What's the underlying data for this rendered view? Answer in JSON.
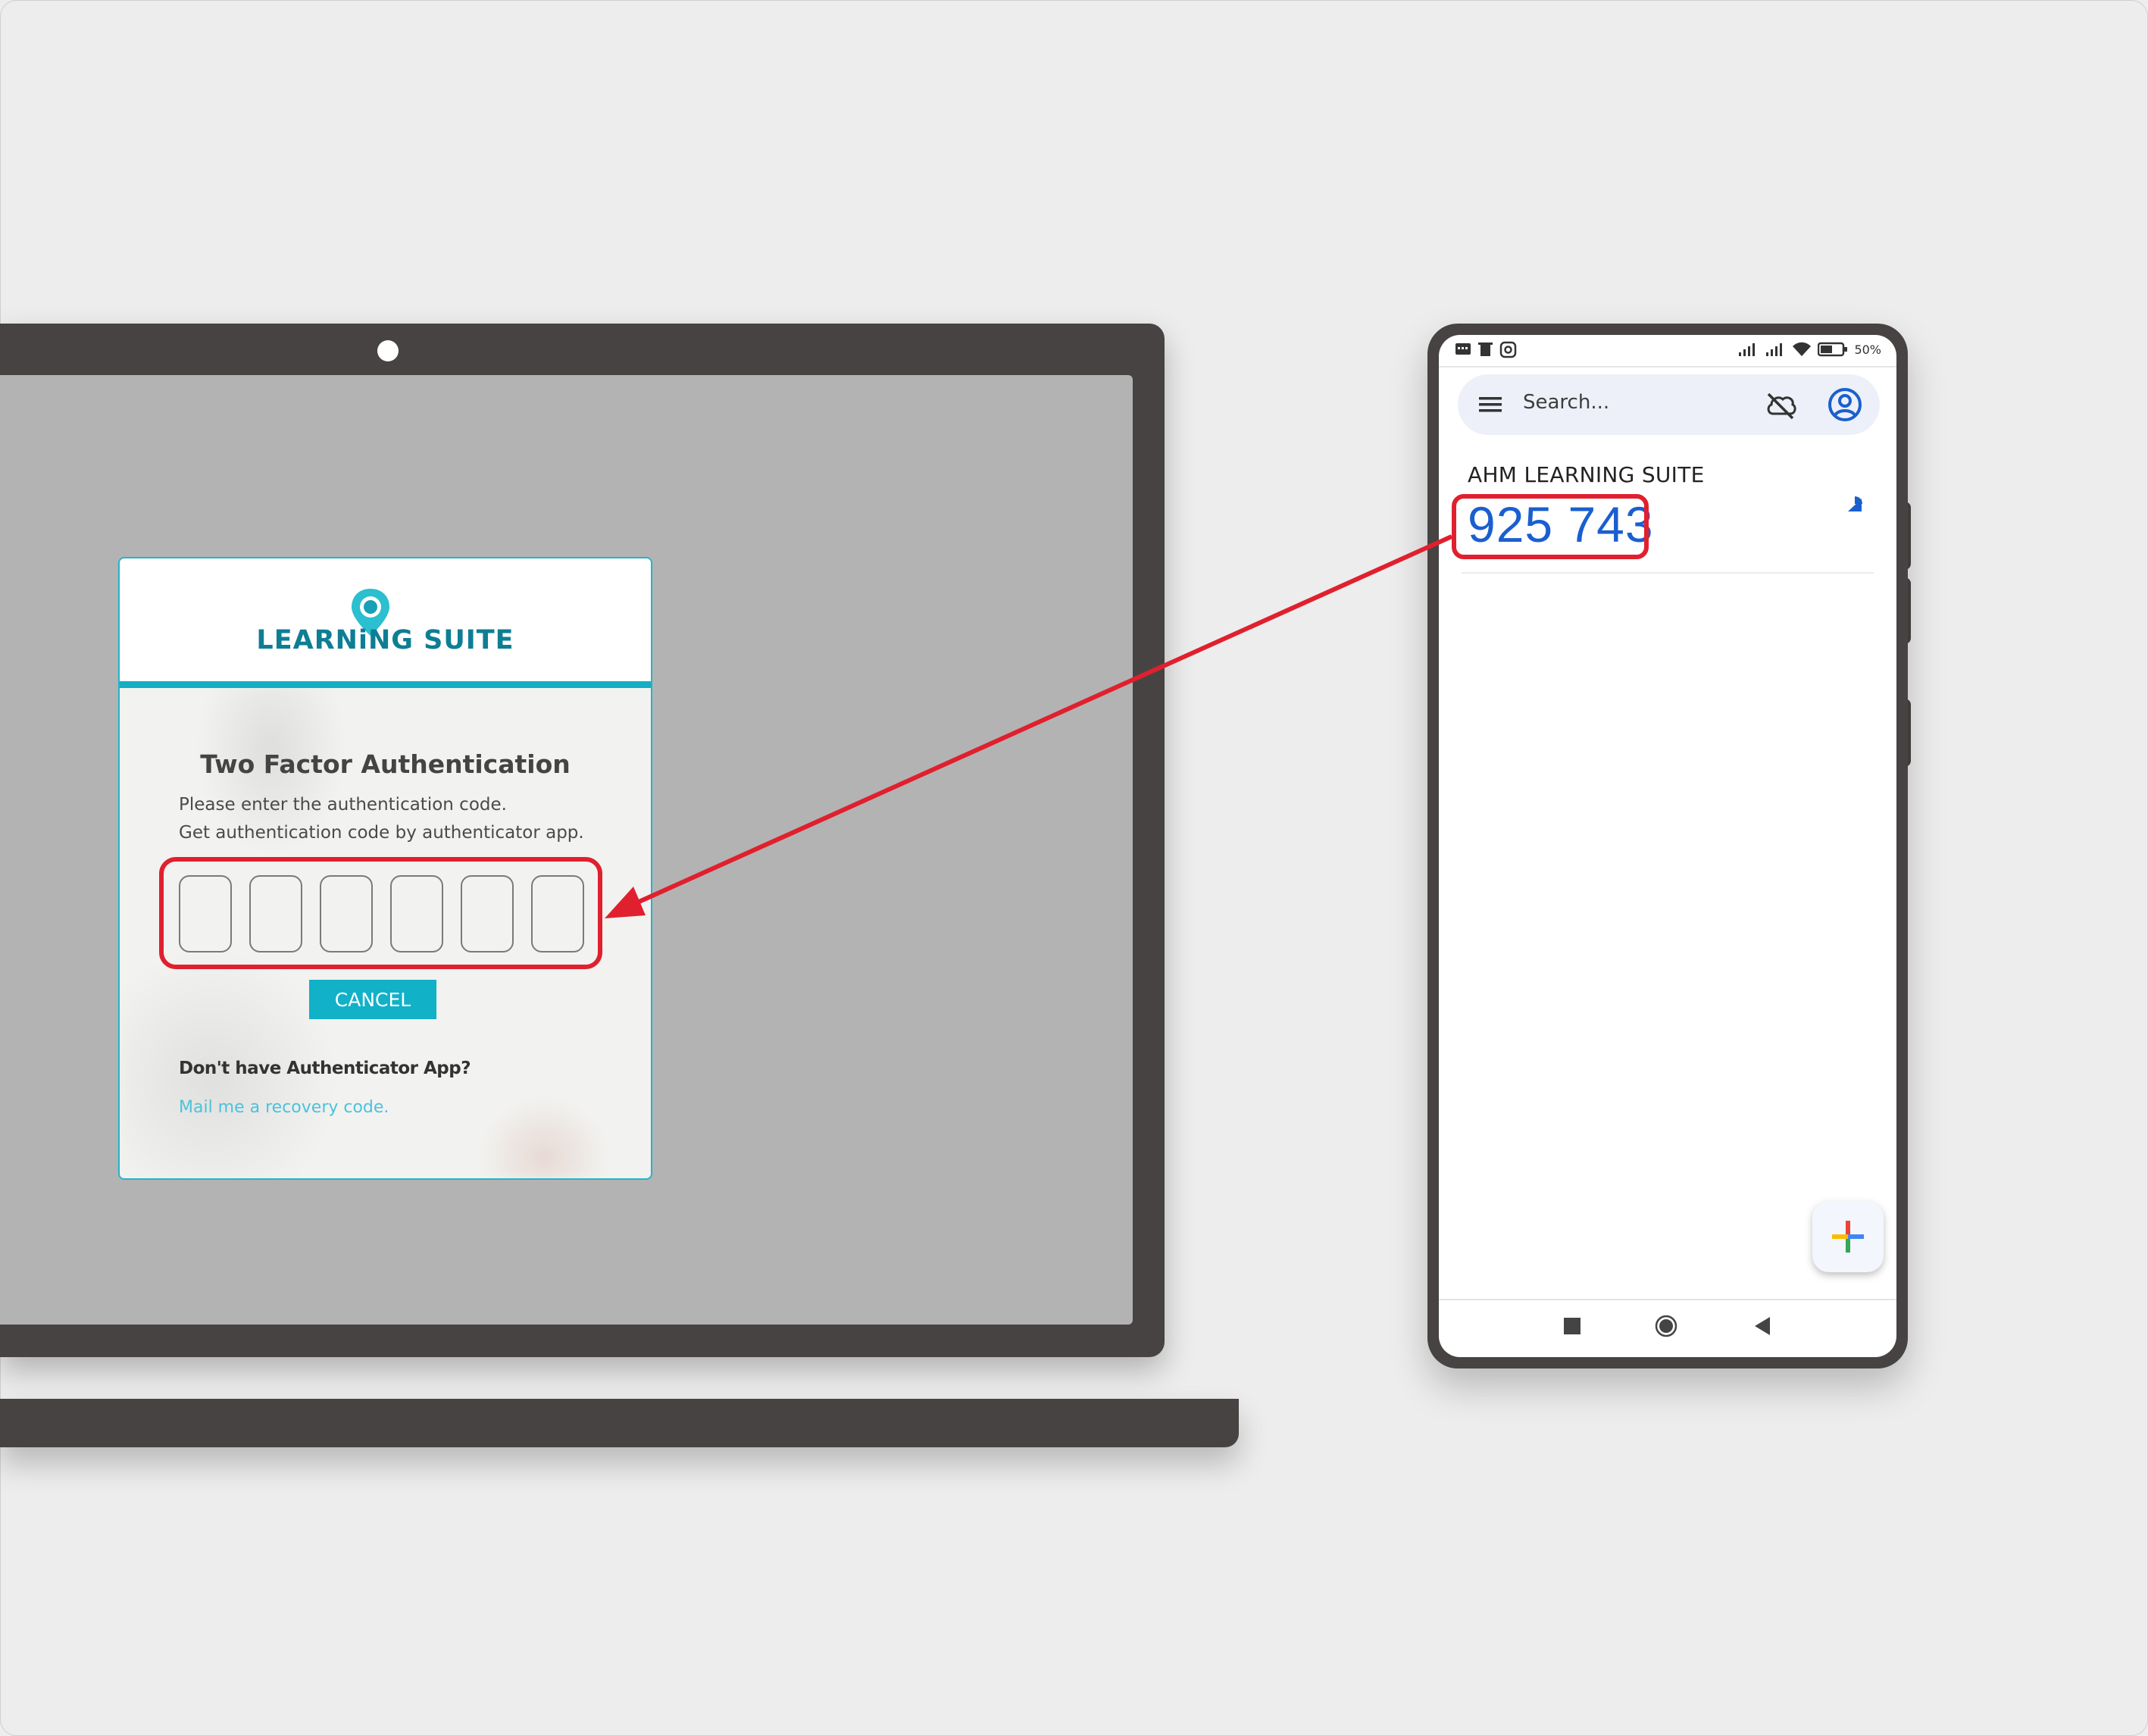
{
  "laptop": {
    "login_card": {
      "logo_text": "LEARNiNG SUITE",
      "title": "Two Factor Authentication",
      "instruction_line1": "Please enter the authentication code.",
      "instruction_line2": "Get authentication code by authenticator app.",
      "code_digits": [
        "",
        "",
        "",
        "",
        "",
        ""
      ],
      "cancel_label": "CANCEL",
      "no_app_text": "Don't have Authenticator App?",
      "recovery_link": "Mail me a recovery code."
    }
  },
  "phone": {
    "status_bar": {
      "left_icons": [
        "message-icon",
        "trash-icon",
        "instagram-icon"
      ],
      "right_icons": [
        "signal-icon",
        "signal-icon",
        "wifi-icon",
        "battery-icon"
      ],
      "battery": "50%"
    },
    "search": {
      "placeholder": "Search..."
    },
    "accounts": [
      {
        "name": "AHM LEARNING SUITE",
        "code": "925 743"
      }
    ],
    "nav_icons": [
      "recents-icon",
      "home-icon",
      "back-icon"
    ]
  },
  "colors": {
    "highlight": "#e0202e",
    "brand_teal": "#14aec6",
    "otp_blue": "#1a5fd0",
    "device_frame": "#474343"
  }
}
